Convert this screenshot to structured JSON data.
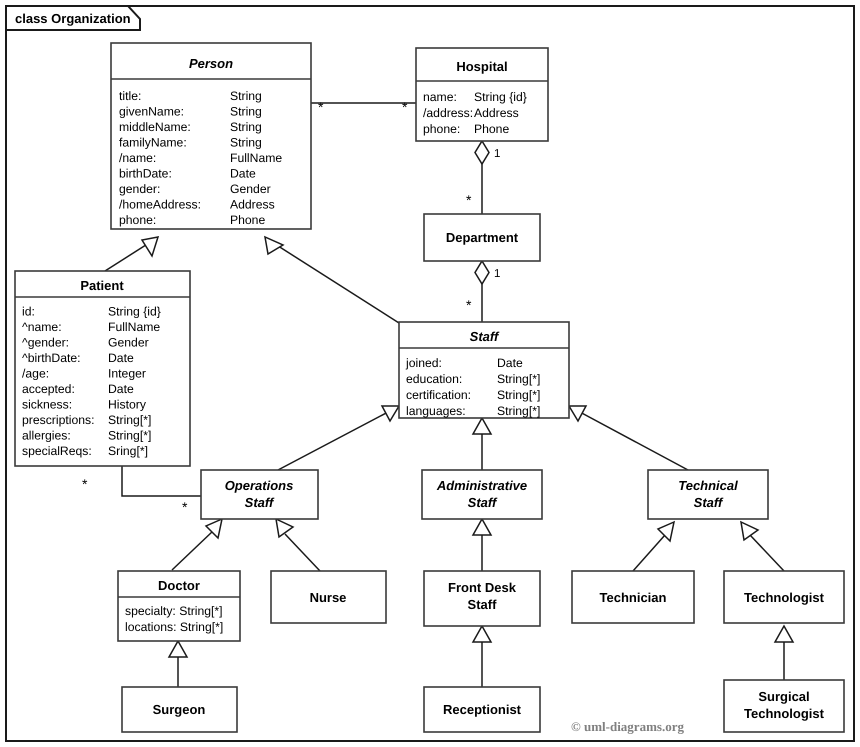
{
  "frame": {
    "tab_label": "class Organization",
    "credit": "© uml-diagrams.org",
    "border_color": "#1a1a1a",
    "background_color": "#ffffff"
  },
  "classes": {
    "person": {
      "name": "Person",
      "abstract": true,
      "attributes": [
        {
          "name": "title:",
          "type": "String"
        },
        {
          "name": "givenName:",
          "type": "String"
        },
        {
          "name": "middleName:",
          "type": "String"
        },
        {
          "name": "familyName:",
          "type": "String"
        },
        {
          "name": "/name:",
          "type": "FullName"
        },
        {
          "name": "birthDate:",
          "type": "Date"
        },
        {
          "name": "gender:",
          "type": "Gender"
        },
        {
          "name": "/homeAddress:",
          "type": "Address"
        },
        {
          "name": "phone:",
          "type": "Phone"
        }
      ]
    },
    "hospital": {
      "name": "Hospital",
      "abstract": false,
      "attributes": [
        {
          "name": "name:",
          "type": "String {id}"
        },
        {
          "name": "/address:",
          "type": "Address"
        },
        {
          "name": "phone:",
          "type": "Phone"
        }
      ]
    },
    "department": {
      "name": "Department",
      "abstract": false,
      "attributes": []
    },
    "patient": {
      "name": "Patient",
      "abstract": false,
      "attributes": [
        {
          "name": "id:",
          "type": "String {id}"
        },
        {
          "name": "^name:",
          "type": "FullName"
        },
        {
          "name": "^gender:",
          "type": "Gender"
        },
        {
          "name": "^birthDate:",
          "type": "Date"
        },
        {
          "name": "/age:",
          "type": "Integer"
        },
        {
          "name": "accepted:",
          "type": "Date"
        },
        {
          "name": "sickness:",
          "type": "History"
        },
        {
          "name": "prescriptions:",
          "type": "String[*]"
        },
        {
          "name": "allergies:",
          "type": "String[*]"
        },
        {
          "name": "specialReqs:",
          "type": "Sring[*]"
        }
      ]
    },
    "staff": {
      "name": "Staff",
      "abstract": true,
      "attributes": [
        {
          "name": "joined:",
          "type": "Date"
        },
        {
          "name": "education:",
          "type": "String[*]"
        },
        {
          "name": "certification:",
          "type": "String[*]"
        },
        {
          "name": "languages:",
          "type": "String[*]"
        }
      ]
    },
    "operations_staff": {
      "name": "Operations Staff",
      "name_line1": "Operations",
      "name_line2": "Staff",
      "abstract": true,
      "attributes": []
    },
    "administrative_staff": {
      "name": "Administrative Staff",
      "name_line1": "Administrative",
      "name_line2": "Staff",
      "abstract": true,
      "attributes": []
    },
    "technical_staff": {
      "name": "Technical Staff",
      "name_line1": "Technical",
      "name_line2": "Staff",
      "abstract": true,
      "attributes": []
    },
    "doctor": {
      "name": "Doctor",
      "abstract": false,
      "attributes": [
        {
          "name": "specialty:",
          "type": "String[*]"
        },
        {
          "name": "locations:",
          "type": "String[*]"
        }
      ]
    },
    "nurse": {
      "name": "Nurse",
      "abstract": false,
      "attributes": []
    },
    "front_desk_staff": {
      "name": "Front Desk Staff",
      "name_line1": "Front Desk",
      "name_line2": "Staff",
      "abstract": false,
      "attributes": []
    },
    "technician": {
      "name": "Technician",
      "abstract": false,
      "attributes": []
    },
    "technologist": {
      "name": "Technologist",
      "abstract": false,
      "attributes": []
    },
    "surgeon": {
      "name": "Surgeon",
      "abstract": false,
      "attributes": []
    },
    "receptionist": {
      "name": "Receptionist",
      "abstract": false,
      "attributes": []
    },
    "surgical_technologist": {
      "name": "Surgical Technologist",
      "name_line1": "Surgical",
      "name_line2": "Technologist",
      "abstract": false,
      "attributes": []
    }
  },
  "relationships": [
    {
      "id": "person-hospital",
      "kind": "association",
      "source": "person",
      "target": "hospital",
      "source_multiplicity": "*",
      "target_multiplicity": "*"
    },
    {
      "id": "hospital-department",
      "kind": "aggregation",
      "source": "hospital",
      "target": "department",
      "source_multiplicity": "1",
      "target_multiplicity": "*"
    },
    {
      "id": "department-staff",
      "kind": "aggregation",
      "source": "department",
      "target": "staff",
      "source_multiplicity": "1",
      "target_multiplicity": "*"
    },
    {
      "id": "patient-person",
      "kind": "generalization",
      "source": "patient",
      "target": "person"
    },
    {
      "id": "staff-person",
      "kind": "generalization",
      "source": "staff",
      "target": "person"
    },
    {
      "id": "patient-operations",
      "kind": "association",
      "source": "patient",
      "target": "operations_staff",
      "source_multiplicity": "*",
      "target_multiplicity": "*"
    },
    {
      "id": "operations-staff",
      "kind": "generalization",
      "source": "operations_staff",
      "target": "staff"
    },
    {
      "id": "administrative-staff",
      "kind": "generalization",
      "source": "administrative_staff",
      "target": "staff"
    },
    {
      "id": "technical-staff",
      "kind": "generalization",
      "source": "technical_staff",
      "target": "staff"
    },
    {
      "id": "doctor-operations",
      "kind": "generalization",
      "source": "doctor",
      "target": "operations_staff"
    },
    {
      "id": "nurse-operations",
      "kind": "generalization",
      "source": "nurse",
      "target": "operations_staff"
    },
    {
      "id": "frontdesk-administrative",
      "kind": "generalization",
      "source": "front_desk_staff",
      "target": "administrative_staff"
    },
    {
      "id": "technician-technical",
      "kind": "generalization",
      "source": "technician",
      "target": "technical_staff"
    },
    {
      "id": "technologist-technical",
      "kind": "generalization",
      "source": "technologist",
      "target": "technical_staff"
    },
    {
      "id": "surgeon-doctor",
      "kind": "generalization",
      "source": "surgeon",
      "target": "doctor"
    },
    {
      "id": "receptionist-frontdesk",
      "kind": "generalization",
      "source": "receptionist",
      "target": "front_desk_staff"
    },
    {
      "id": "surgical-technologist",
      "kind": "generalization",
      "source": "surgical_technologist",
      "target": "technologist"
    }
  ]
}
